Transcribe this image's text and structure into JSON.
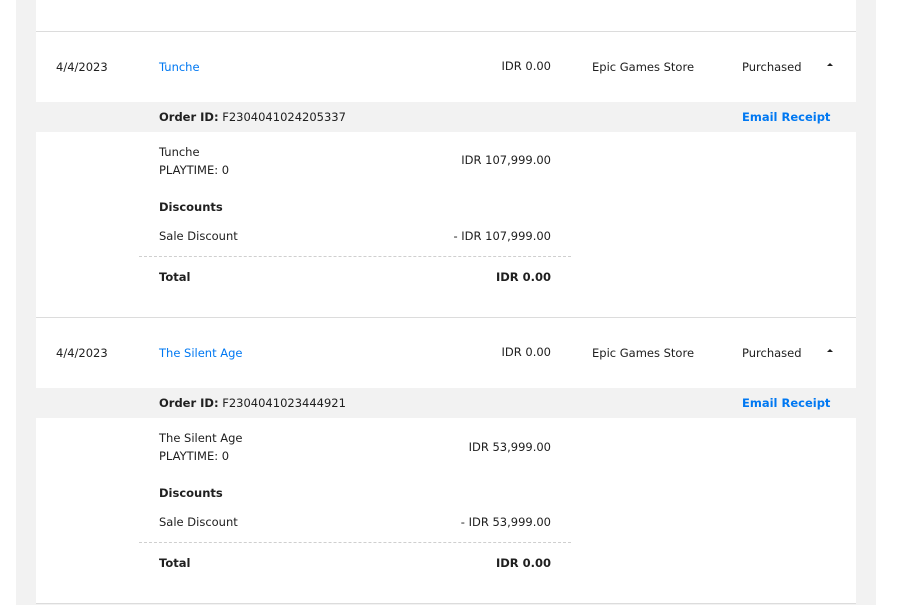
{
  "orders": [
    {
      "date": "4/4/2023",
      "title": "Tunche",
      "price": "IDR 0.00",
      "store": "Epic Games Store",
      "status": "Purchased",
      "order_label": "Order ID:",
      "order_id": "F2304041024205337",
      "email_receipt": "Email Receipt",
      "item_name": "Tunche",
      "playtime": "PLAYTIME: 0",
      "item_price": "IDR 107,999.00",
      "discounts_label": "Discounts",
      "discount_name": "Sale Discount",
      "discount_value": "- IDR 107,999.00",
      "total_label": "Total",
      "total_value": "IDR 0.00"
    },
    {
      "date": "4/4/2023",
      "title": "The Silent Age",
      "price": "IDR 0.00",
      "store": "Epic Games Store",
      "status": "Purchased",
      "order_label": "Order ID:",
      "order_id": "F2304041023444921",
      "email_receipt": "Email Receipt",
      "item_name": "The Silent Age",
      "playtime": "PLAYTIME: 0",
      "item_price": "IDR 53,999.00",
      "discounts_label": "Discounts",
      "discount_name": "Sale Discount",
      "discount_value": "- IDR 53,999.00",
      "total_label": "Total",
      "total_value": "IDR 0.00"
    }
  ]
}
